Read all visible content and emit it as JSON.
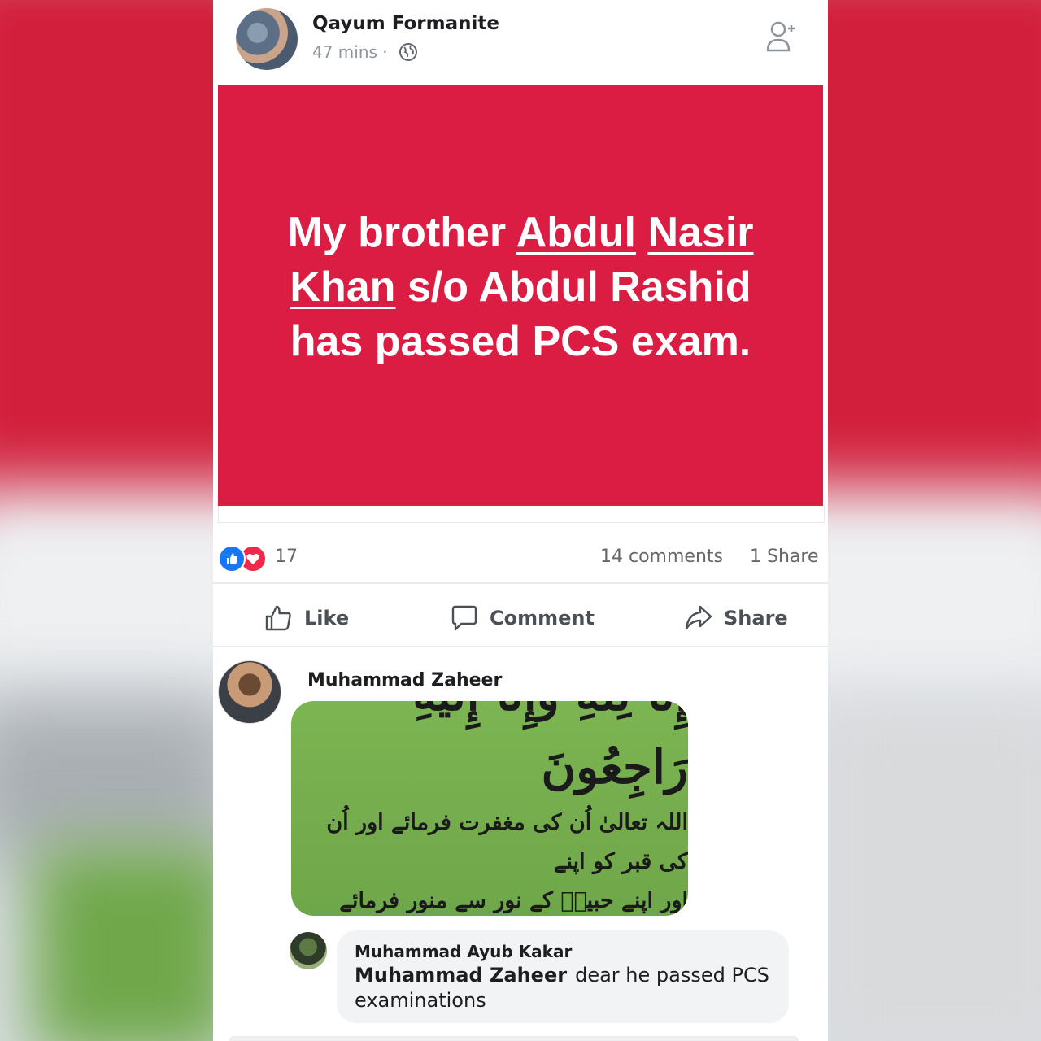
{
  "post": {
    "author": "Qayum Formanite",
    "time": "47 mins ·",
    "banner": {
      "part1": "My brother",
      "tagged_name_line1": "Abdul",
      "tagged_name_line2": "Nasir Khan",
      "part2": "s/o Abdul Rashid has passed PCS exam."
    }
  },
  "stats": {
    "reactions": "17",
    "comments": "14 comments",
    "shares": "1 Share"
  },
  "actions": {
    "like": "Like",
    "comment": "Comment",
    "share": "Share"
  },
  "comments": {
    "first": {
      "author": "Muhammad Zaheer",
      "image_text": {
        "title": "إِنَّا لِلّٰهِ وَإِنَّا إِلَيْهِ رَاجِعُونَ",
        "line1": "اللہ تعالیٰ اُن کی مغفرت فرمائے اور اُن کی قبر کو اپنے",
        "line2": "اور اپنے حبیبؐ کے نور سے منور فرمائے آمین"
      }
    },
    "reply": {
      "author": "Muhammad Ayub Kakar",
      "mention": "Muhammad Zaheer",
      "text": "dear he passed PCS examinations"
    }
  },
  "colors": {
    "banner": "#dc1d43",
    "like_blue": "#1877f2",
    "love_red": "#f0284a",
    "urdu_card_green": "#76ad4e"
  },
  "icons": [
    "globe-icon",
    "add-friend-icon",
    "like-reaction-icon",
    "love-reaction-icon",
    "thumbs-up-icon",
    "comment-icon",
    "share-icon"
  ]
}
